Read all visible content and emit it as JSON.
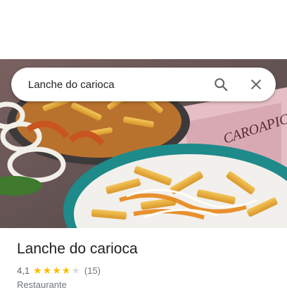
{
  "search": {
    "query": "Lanche do carioca",
    "search_icon": "search-icon",
    "close_icon": "close-icon"
  },
  "hero_photo": {
    "description_icon": "place-photo",
    "package_text": "CAROAPIC"
  },
  "place": {
    "name": "Lanche do carioca",
    "rating_text": "4,1",
    "rating": 4.1,
    "stars_max": 5,
    "reviews_text": "(15)",
    "category": "Restaurante"
  },
  "colors": {
    "star_filled": "#fbbc04",
    "star_empty": "#dadce0",
    "title": "#202124",
    "secondary": "#70757a"
  }
}
